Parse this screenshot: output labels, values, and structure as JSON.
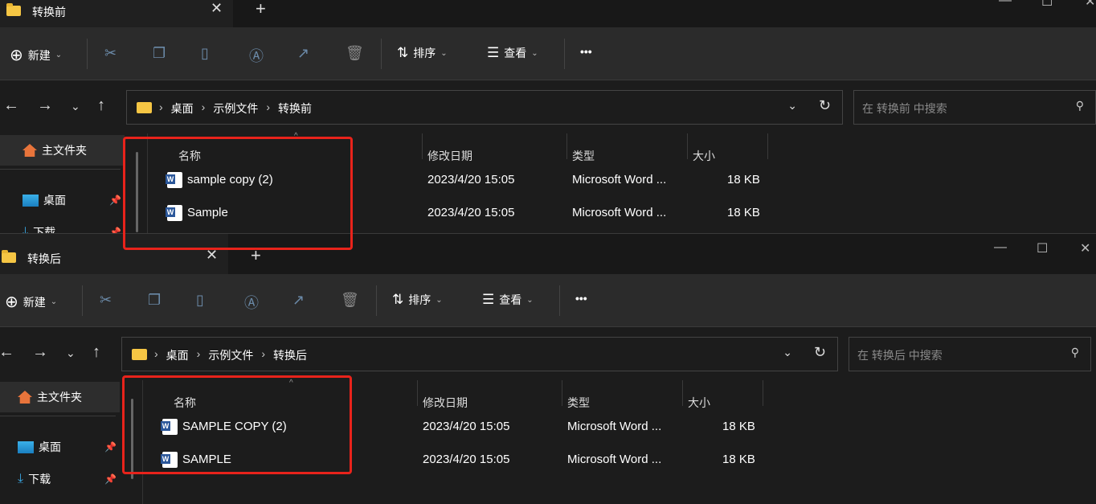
{
  "windows": [
    {
      "tab_title": "转换前",
      "toolbar": {
        "new": "新建",
        "sort": "排序",
        "view": "查看",
        "more": "•••"
      },
      "breadcrumb": [
        "桌面",
        "示例文件",
        "转换前"
      ],
      "search_placeholder": "在 转换前 中搜索",
      "sidebar": [
        {
          "label": "主文件夹"
        },
        {
          "label": "桌面"
        },
        {
          "label": "下载"
        }
      ],
      "columns": {
        "name": "名称",
        "date": "修改日期",
        "type": "类型",
        "size": "大小"
      },
      "files": [
        {
          "name": "sample copy (2)",
          "date": "2023/4/20 15:05",
          "type": "Microsoft Word ...",
          "size": "18 KB"
        },
        {
          "name": "Sample",
          "date": "2023/4/20 15:05",
          "type": "Microsoft Word ...",
          "size": "18 KB"
        }
      ]
    },
    {
      "tab_title": "转换后",
      "toolbar": {
        "new": "新建",
        "sort": "排序",
        "view": "查看",
        "more": "•••"
      },
      "breadcrumb": [
        "桌面",
        "示例文件",
        "转换后"
      ],
      "search_placeholder": "在 转换后 中搜索",
      "sidebar": [
        {
          "label": "主文件夹"
        },
        {
          "label": "桌面"
        },
        {
          "label": "下载"
        }
      ],
      "columns": {
        "name": "名称",
        "date": "修改日期",
        "type": "类型",
        "size": "大小"
      },
      "files": [
        {
          "name": "SAMPLE COPY (2)",
          "date": "2023/4/20 15:05",
          "type": "Microsoft Word ...",
          "size": "18 KB"
        },
        {
          "name": "SAMPLE",
          "date": "2023/4/20 15:05",
          "type": "Microsoft Word ...",
          "size": "18 KB"
        }
      ]
    }
  ],
  "colors": {
    "highlight": "#e8231b",
    "accent_folder": "#f6c644"
  }
}
